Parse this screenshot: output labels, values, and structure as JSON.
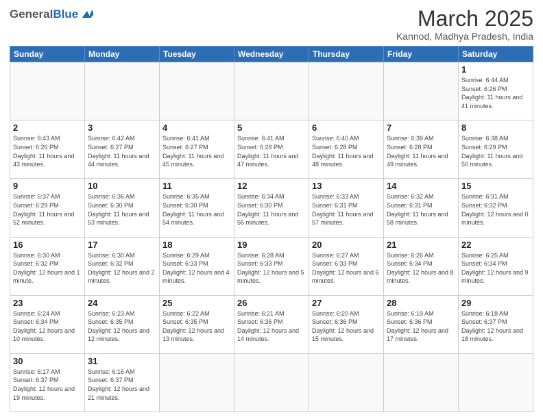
{
  "header": {
    "logo_general": "General",
    "logo_blue": "Blue",
    "month_title": "March 2025",
    "location": "Kannod, Madhya Pradesh, India"
  },
  "weekdays": [
    "Sunday",
    "Monday",
    "Tuesday",
    "Wednesday",
    "Thursday",
    "Friday",
    "Saturday"
  ],
  "weeks": [
    [
      null,
      null,
      null,
      null,
      null,
      null,
      {
        "day": "1",
        "sunrise": "Sunrise: 6:44 AM",
        "sunset": "Sunset: 6:26 PM",
        "daylight": "Daylight: 11 hours and 41 minutes."
      }
    ],
    [
      {
        "day": "2",
        "sunrise": "Sunrise: 6:43 AM",
        "sunset": "Sunset: 6:26 PM",
        "daylight": "Daylight: 11 hours and 43 minutes."
      },
      {
        "day": "3",
        "sunrise": "Sunrise: 6:42 AM",
        "sunset": "Sunset: 6:27 PM",
        "daylight": "Daylight: 11 hours and 44 minutes."
      },
      {
        "day": "4",
        "sunrise": "Sunrise: 6:41 AM",
        "sunset": "Sunset: 6:27 PM",
        "daylight": "Daylight: 11 hours and 45 minutes."
      },
      {
        "day": "5",
        "sunrise": "Sunrise: 6:41 AM",
        "sunset": "Sunset: 6:28 PM",
        "daylight": "Daylight: 11 hours and 47 minutes."
      },
      {
        "day": "6",
        "sunrise": "Sunrise: 6:40 AM",
        "sunset": "Sunset: 6:28 PM",
        "daylight": "Daylight: 11 hours and 48 minutes."
      },
      {
        "day": "7",
        "sunrise": "Sunrise: 6:39 AM",
        "sunset": "Sunset: 6:28 PM",
        "daylight": "Daylight: 11 hours and 49 minutes."
      },
      {
        "day": "8",
        "sunrise": "Sunrise: 6:38 AM",
        "sunset": "Sunset: 6:29 PM",
        "daylight": "Daylight: 11 hours and 50 minutes."
      }
    ],
    [
      {
        "day": "9",
        "sunrise": "Sunrise: 6:37 AM",
        "sunset": "Sunset: 6:29 PM",
        "daylight": "Daylight: 11 hours and 52 minutes."
      },
      {
        "day": "10",
        "sunrise": "Sunrise: 6:36 AM",
        "sunset": "Sunset: 6:30 PM",
        "daylight": "Daylight: 11 hours and 53 minutes."
      },
      {
        "day": "11",
        "sunrise": "Sunrise: 6:35 AM",
        "sunset": "Sunset: 6:30 PM",
        "daylight": "Daylight: 11 hours and 54 minutes."
      },
      {
        "day": "12",
        "sunrise": "Sunrise: 6:34 AM",
        "sunset": "Sunset: 6:30 PM",
        "daylight": "Daylight: 11 hours and 56 minutes."
      },
      {
        "day": "13",
        "sunrise": "Sunrise: 6:33 AM",
        "sunset": "Sunset: 6:31 PM",
        "daylight": "Daylight: 11 hours and 57 minutes."
      },
      {
        "day": "14",
        "sunrise": "Sunrise: 6:32 AM",
        "sunset": "Sunset: 6:31 PM",
        "daylight": "Daylight: 11 hours and 58 minutes."
      },
      {
        "day": "15",
        "sunrise": "Sunrise: 6:31 AM",
        "sunset": "Sunset: 6:32 PM",
        "daylight": "Daylight: 12 hours and 0 minutes."
      }
    ],
    [
      {
        "day": "16",
        "sunrise": "Sunrise: 6:30 AM",
        "sunset": "Sunset: 6:32 PM",
        "daylight": "Daylight: 12 hours and 1 minute."
      },
      {
        "day": "17",
        "sunrise": "Sunrise: 6:30 AM",
        "sunset": "Sunset: 6:32 PM",
        "daylight": "Daylight: 12 hours and 2 minutes."
      },
      {
        "day": "18",
        "sunrise": "Sunrise: 6:29 AM",
        "sunset": "Sunset: 6:33 PM",
        "daylight": "Daylight: 12 hours and 4 minutes."
      },
      {
        "day": "19",
        "sunrise": "Sunrise: 6:28 AM",
        "sunset": "Sunset: 6:33 PM",
        "daylight": "Daylight: 12 hours and 5 minutes."
      },
      {
        "day": "20",
        "sunrise": "Sunrise: 6:27 AM",
        "sunset": "Sunset: 6:33 PM",
        "daylight": "Daylight: 12 hours and 6 minutes."
      },
      {
        "day": "21",
        "sunrise": "Sunrise: 6:26 AM",
        "sunset": "Sunset: 6:34 PM",
        "daylight": "Daylight: 12 hours and 8 minutes."
      },
      {
        "day": "22",
        "sunrise": "Sunrise: 6:25 AM",
        "sunset": "Sunset: 6:34 PM",
        "daylight": "Daylight: 12 hours and 9 minutes."
      }
    ],
    [
      {
        "day": "23",
        "sunrise": "Sunrise: 6:24 AM",
        "sunset": "Sunset: 6:34 PM",
        "daylight": "Daylight: 12 hours and 10 minutes."
      },
      {
        "day": "24",
        "sunrise": "Sunrise: 6:23 AM",
        "sunset": "Sunset: 6:35 PM",
        "daylight": "Daylight: 12 hours and 12 minutes."
      },
      {
        "day": "25",
        "sunrise": "Sunrise: 6:22 AM",
        "sunset": "Sunset: 6:35 PM",
        "daylight": "Daylight: 12 hours and 13 minutes."
      },
      {
        "day": "26",
        "sunrise": "Sunrise: 6:21 AM",
        "sunset": "Sunset: 6:36 PM",
        "daylight": "Daylight: 12 hours and 14 minutes."
      },
      {
        "day": "27",
        "sunrise": "Sunrise: 6:20 AM",
        "sunset": "Sunset: 6:36 PM",
        "daylight": "Daylight: 12 hours and 15 minutes."
      },
      {
        "day": "28",
        "sunrise": "Sunrise: 6:19 AM",
        "sunset": "Sunset: 6:36 PM",
        "daylight": "Daylight: 12 hours and 17 minutes."
      },
      {
        "day": "29",
        "sunrise": "Sunrise: 6:18 AM",
        "sunset": "Sunset: 6:37 PM",
        "daylight": "Daylight: 12 hours and 18 minutes."
      }
    ],
    [
      {
        "day": "30",
        "sunrise": "Sunrise: 6:17 AM",
        "sunset": "Sunset: 6:37 PM",
        "daylight": "Daylight: 12 hours and 19 minutes."
      },
      {
        "day": "31",
        "sunrise": "Sunrise: 6:16 AM",
        "sunset": "Sunset: 6:37 PM",
        "daylight": "Daylight: 12 hours and 21 minutes."
      },
      null,
      null,
      null,
      null,
      null
    ]
  ]
}
